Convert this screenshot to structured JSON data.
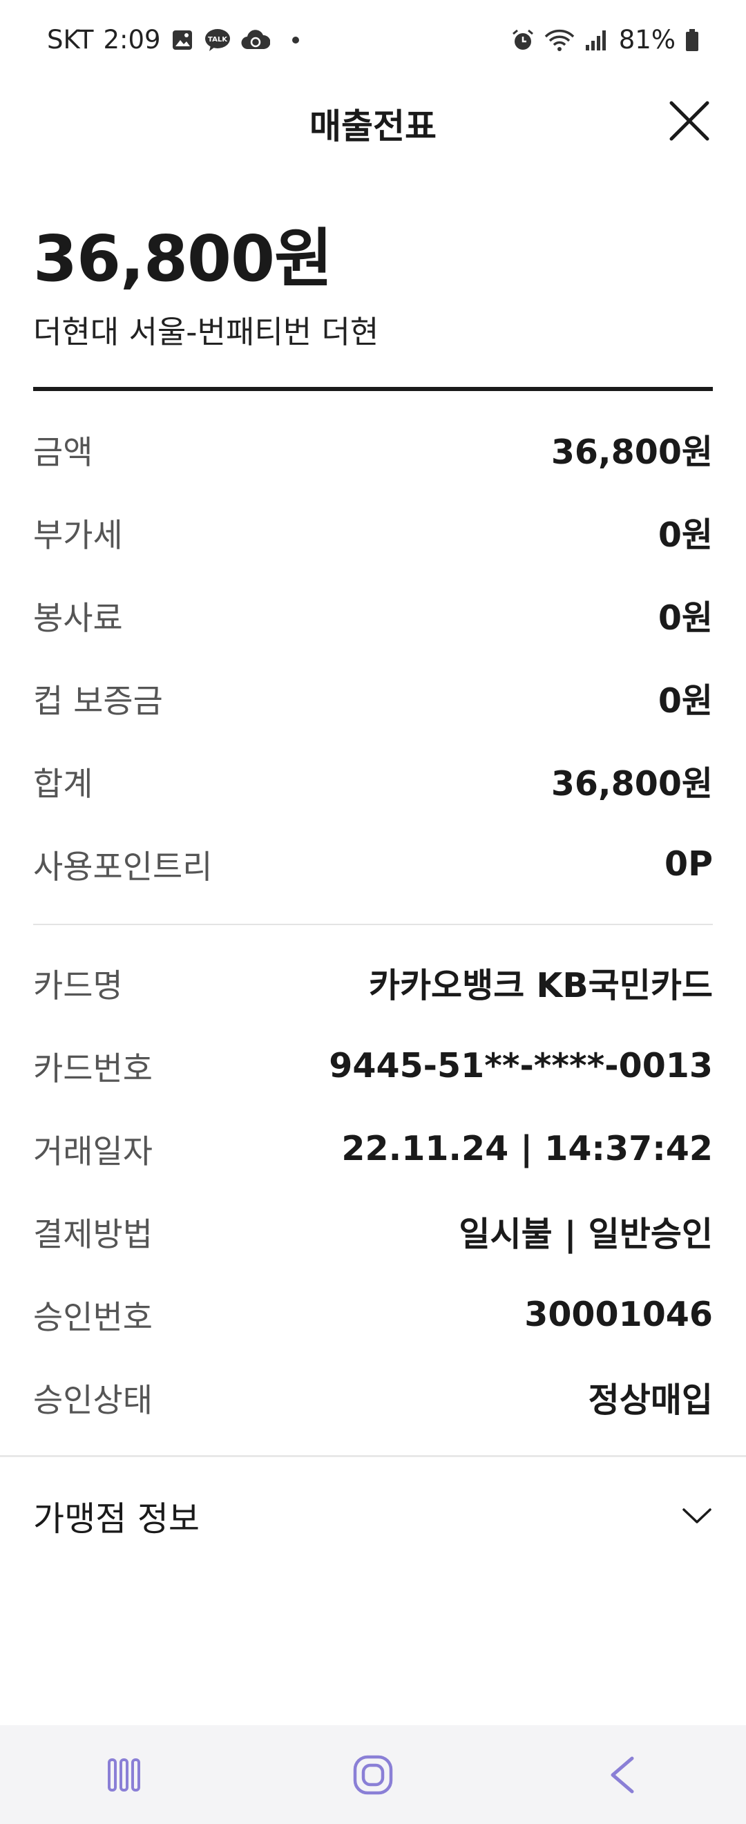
{
  "status_bar": {
    "carrier": "SKT",
    "time": "2:09",
    "battery": "81%",
    "icons_left": [
      "image-icon",
      "kakaotalk-icon",
      "cloud-sync-icon"
    ],
    "icons_right": [
      "alarm-icon",
      "wifi-icon",
      "signal-icon",
      "battery-icon"
    ]
  },
  "header": {
    "title": "매출전표",
    "close_icon": "close-icon"
  },
  "summary": {
    "amount": "36,800원",
    "merchant": "더현대 서울-번패티번 더현"
  },
  "amount_details": [
    {
      "label": "금액",
      "value": "36,800원"
    },
    {
      "label": "부가세",
      "value": "0원"
    },
    {
      "label": "봉사료",
      "value": "0원"
    },
    {
      "label": "컵 보증금",
      "value": "0원"
    },
    {
      "label": "합계",
      "value": "36,800원"
    },
    {
      "label": "사용포인트리",
      "value": "0P"
    }
  ],
  "card_details": [
    {
      "label": "카드명",
      "value": "카카오뱅크 KB국민카드"
    },
    {
      "label": "카드번호",
      "value": "9445-51**-****-0013"
    },
    {
      "label": "거래일자",
      "value": "22.11.24 | 14:37:42"
    },
    {
      "label": "결제방법",
      "value": "일시불 | 일반승인"
    },
    {
      "label": "승인번호",
      "value": "30001046"
    },
    {
      "label": "승인상태",
      "value": "정상매입"
    }
  ],
  "merchant_info": {
    "label": "가맹점 정보",
    "icon": "chevron-down-icon"
  },
  "nav": {
    "icons": [
      "recent-apps-icon",
      "home-icon",
      "back-icon"
    ],
    "accent": "#8a7fd6"
  }
}
